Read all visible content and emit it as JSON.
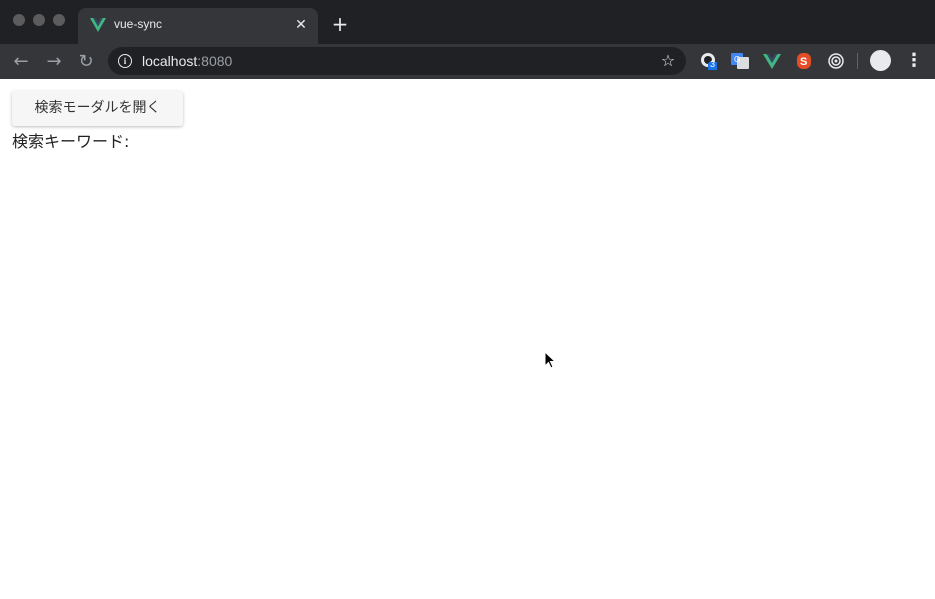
{
  "browser": {
    "tab": {
      "title": "vue-sync",
      "favicon": "vue-logo-icon"
    },
    "address": {
      "host": "localhost",
      "port": ":8080"
    },
    "extensions": [
      {
        "name": "octocat-extension-icon",
        "badge": "3"
      },
      {
        "name": "google-translate-icon"
      },
      {
        "name": "vue-devtools-icon"
      },
      {
        "name": "svelte-extension-icon"
      },
      {
        "name": "target-extension-icon"
      }
    ],
    "colors": {
      "frame": "#202124",
      "toolbar": "#35363a",
      "vue_green": "#41b883"
    }
  },
  "page": {
    "open_modal_label": "検索モーダルを開く",
    "keyword_label": "検索キーワード:",
    "keyword_value": ""
  }
}
